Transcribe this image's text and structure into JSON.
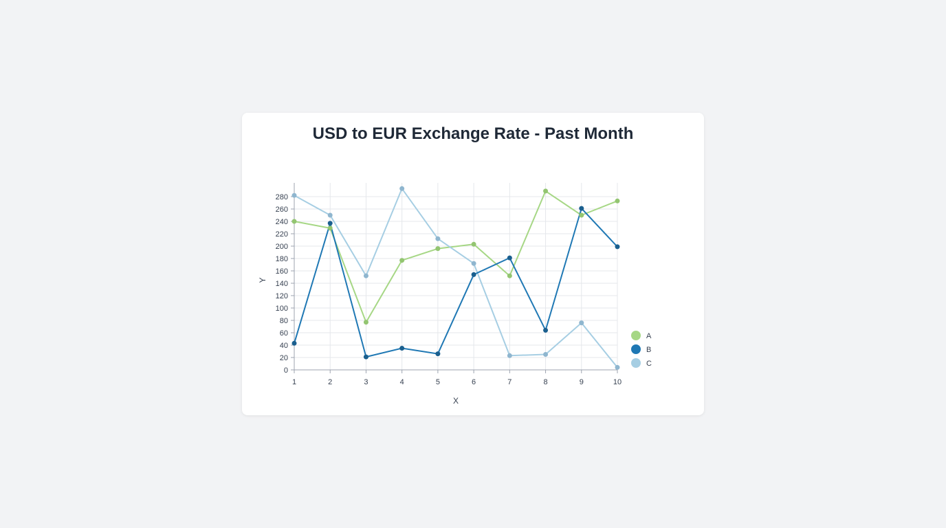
{
  "chart_data": {
    "type": "line",
    "title": "USD to EUR Exchange Rate - Past Month",
    "xlabel": "X",
    "ylabel": "Y",
    "x": [
      1,
      2,
      3,
      4,
      5,
      6,
      7,
      8,
      9,
      10
    ],
    "xlim": [
      1,
      10
    ],
    "ylim": [
      0,
      290
    ],
    "yticks": [
      0,
      20,
      40,
      60,
      80,
      100,
      120,
      140,
      160,
      180,
      200,
      220,
      240,
      260,
      280
    ],
    "grid": true,
    "legend_position": "bottom-right",
    "series": [
      {
        "name": "A",
        "color": "#a6d785",
        "point_color": "#93c571",
        "values": [
          240,
          229,
          77,
          177,
          196,
          203,
          152,
          289,
          250,
          273
        ]
      },
      {
        "name": "B",
        "color": "#1f78b4",
        "point_color": "#1a5f8e",
        "values": [
          43,
          237,
          21,
          35,
          26,
          154,
          181,
          64,
          261,
          199
        ]
      },
      {
        "name": "C",
        "color": "#a6cee3",
        "point_color": "#8fb6cf",
        "values": [
          282,
          250,
          152,
          293,
          212,
          172,
          23,
          25,
          76,
          4
        ]
      }
    ]
  }
}
